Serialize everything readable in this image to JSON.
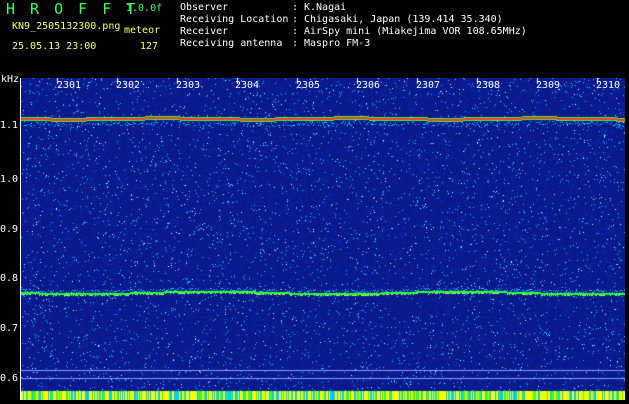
{
  "header": {
    "app_title": "H R O F F T",
    "version": "1.0.0f",
    "filename": "KN9_2505132300.png",
    "datetime": "25.05.13 23:00",
    "meteor_label": "meteor",
    "meteor_count": "127"
  },
  "info": {
    "rows": [
      {
        "key": "Observer",
        "sep": ":",
        "value": "K.Nagai"
      },
      {
        "key": "Receiving Location",
        "sep": ":",
        "value": "Chigasaki, Japan (139.414 35.340)"
      },
      {
        "key": "Receiver",
        "sep": ":",
        "value": "AirSpy mini (Miakejima VOR 108.65MHz)"
      },
      {
        "key": "Receiving antenna",
        "sep": ":",
        "value": "Maspro FM-3"
      }
    ]
  },
  "plot": {
    "y_unit": "kHz",
    "y_ticks": [
      "1.1",
      "1.0",
      "0.9",
      "0.8",
      "0.7",
      "0.6"
    ],
    "x_ticks": [
      "2301",
      "2302",
      "2303",
      "2304",
      "2305",
      "2306",
      "2307",
      "2308",
      "2309",
      "2310"
    ],
    "colors": {
      "background": "#0a1a8c",
      "noise_low": "#0033cc",
      "noise_mid": "#00ccff",
      "trace_strong": "#ff3333",
      "trace_mid": "#33ff33",
      "bottom_strip": "#ffff00"
    }
  }
}
